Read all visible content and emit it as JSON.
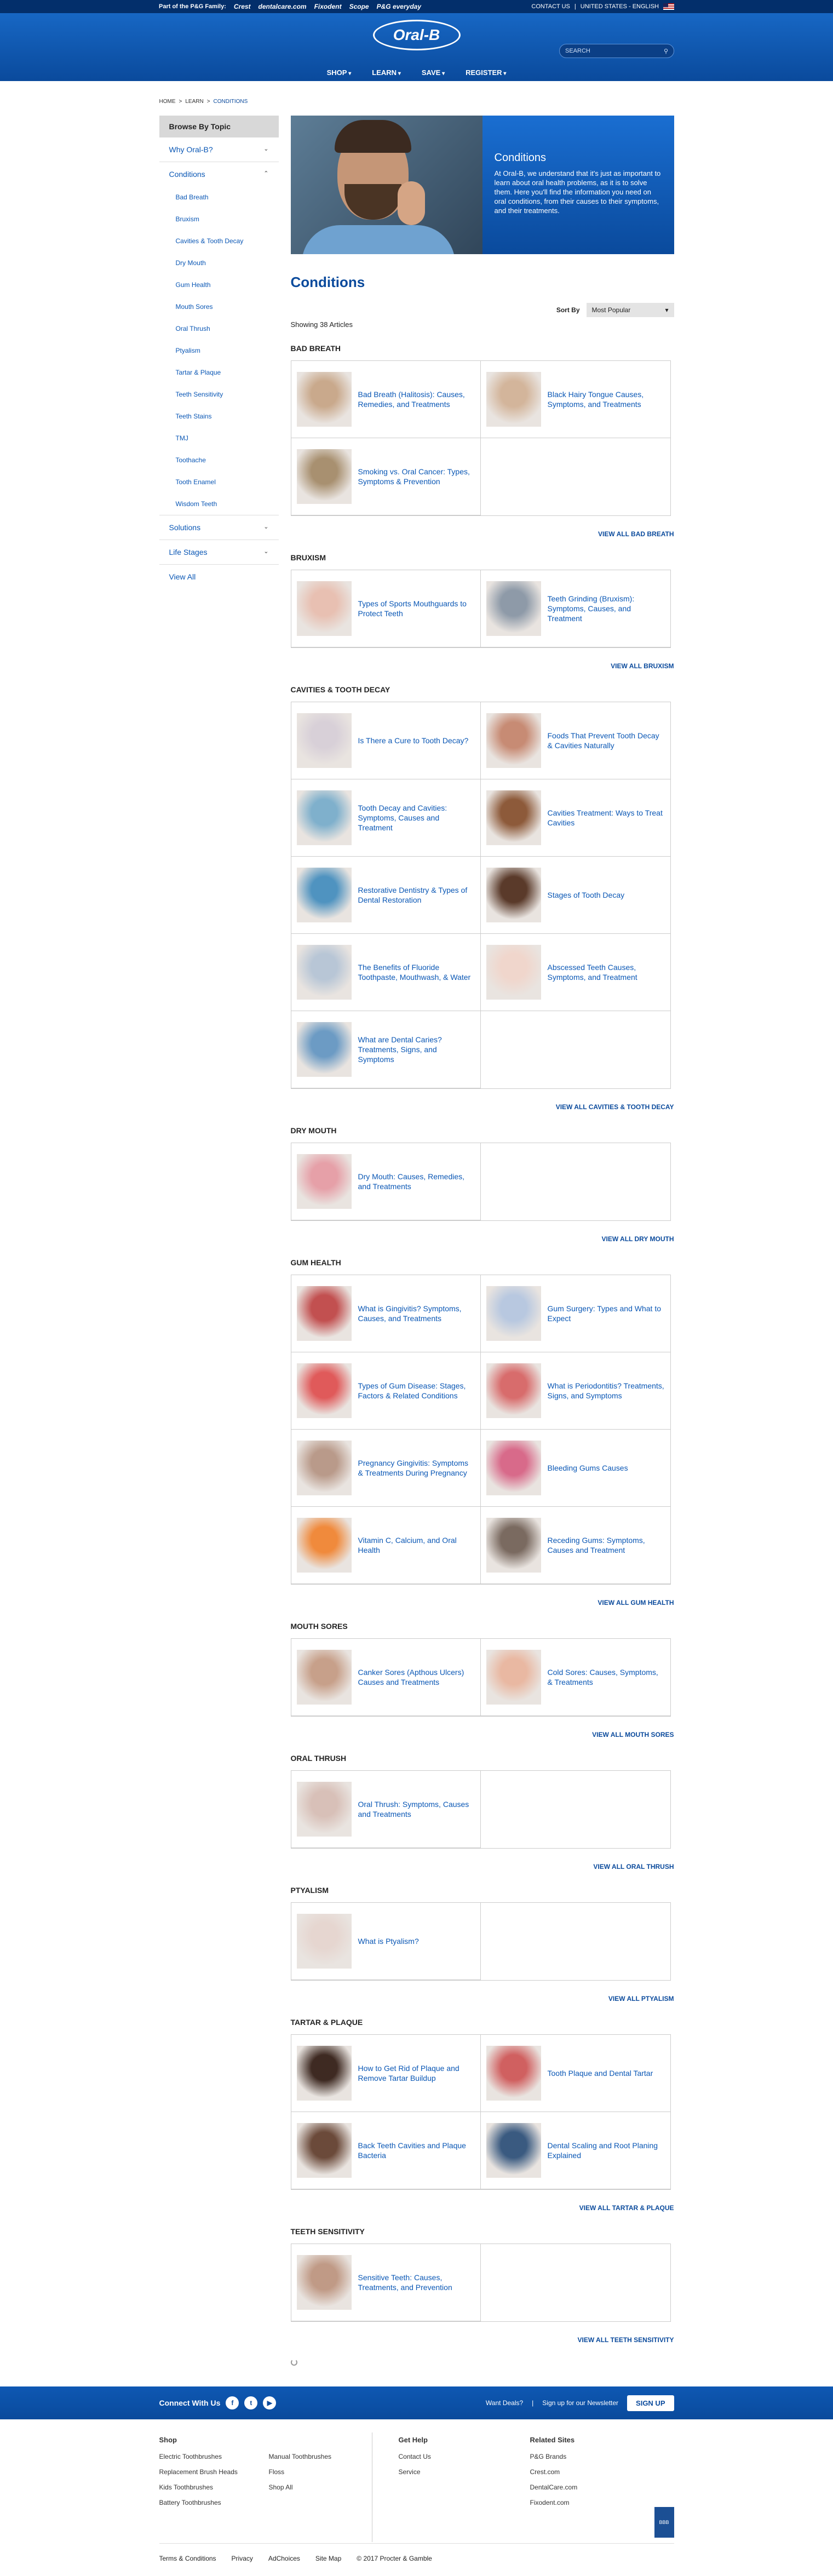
{
  "topbar": {
    "family": "Part of the P&G Family:",
    "brands": [
      "Crest",
      "dentalcare.com",
      "Fixodent",
      "Scope",
      "P&G everyday"
    ],
    "contact": "CONTACT US",
    "region": "UNITED STATES - ENGLISH"
  },
  "header": {
    "logo": "Oral-B",
    "search_placeholder": "SEARCH",
    "nav": [
      "SHOP",
      "LEARN",
      "SAVE",
      "REGISTER"
    ]
  },
  "breadcrumbs": [
    "HOME",
    ">",
    "LEARN",
    ">",
    "CONDITIONS"
  ],
  "sidebar": {
    "title": "Browse By Topic",
    "sections": [
      {
        "label": "Why Oral-B?"
      },
      {
        "label": "Conditions"
      }
    ],
    "subitems": [
      "Bad Breath",
      "Bruxism",
      "Cavities & Tooth Decay",
      "Dry Mouth",
      "Gum Health",
      "Mouth Sores",
      "Oral Thrush",
      "Ptyalism",
      "Tartar & Plaque",
      "Teeth Sensitivity",
      "Teeth Stains",
      "TMJ",
      "Toothache",
      "Tooth Enamel",
      "Wisdom Teeth"
    ],
    "lower": [
      {
        "label": "Solutions"
      },
      {
        "label": "Life Stages"
      }
    ],
    "view_all": "View All"
  },
  "hero": {
    "title": "Conditions",
    "text": "At Oral-B, we understand that it's just as important to learn about oral health problems, as it is to solve them. Here you'll find the information you need on oral conditions, from their causes to their symptoms, and their treatments."
  },
  "page_title": "Conditions",
  "sort": {
    "label": "Sort By",
    "value": "Most Popular"
  },
  "showing": "Showing 38 Articles",
  "categories": [
    {
      "title": "BAD BREATH",
      "view_all": "VIEW ALL BAD BREATH",
      "articles": [
        "Bad Breath (Halitosis): Causes, Remedies, and Treatments",
        "Black Hairy Tongue Causes, Symptoms, and Treatments",
        "Smoking vs. Oral Cancer: Types, Symptoms & Prevention"
      ]
    },
    {
      "title": "BRUXISM",
      "view_all": "VIEW ALL BRUXISM",
      "articles": [
        "Types of Sports Mouthguards to Protect Teeth",
        "Teeth Grinding (Bruxism): Symptoms, Causes, and Treatment"
      ]
    },
    {
      "title": "CAVITIES & TOOTH DECAY",
      "view_all": "VIEW ALL CAVITIES & TOOTH DECAY",
      "articles": [
        "Is There a Cure to Tooth Decay?",
        "Foods That Prevent Tooth Decay & Cavities Naturally",
        "Tooth Decay and Cavities: Symptoms, Causes and Treatment",
        "Cavities Treatment: Ways to Treat Cavities",
        "Restorative Dentistry & Types of Dental Restoration",
        "Stages of Tooth Decay",
        "The Benefits of Fluoride Toothpaste, Mouthwash, & Water",
        "Abscessed Teeth Causes, Symptoms, and Treatment",
        "What are Dental Caries? Treatments, Signs, and Symptoms"
      ]
    },
    {
      "title": "DRY MOUTH",
      "view_all": "VIEW ALL DRY MOUTH",
      "articles": [
        "Dry Mouth: Causes, Remedies, and Treatments"
      ]
    },
    {
      "title": "GUM HEALTH",
      "view_all": "VIEW ALL GUM HEALTH",
      "articles": [
        "What is Gingivitis? Symptoms, Causes, and Treatments",
        "Gum Surgery: Types and What to Expect",
        "Types of Gum Disease: Stages, Factors & Related Conditions",
        "What is Periodontitis? Treatments, Signs, and Symptoms",
        "Pregnancy Gingivitis: Symptoms & Treatments During Pregnancy",
        "Bleeding Gums Causes",
        "Vitamin C, Calcium, and Oral Health",
        "Receding Gums: Symptoms, Causes and Treatment"
      ]
    },
    {
      "title": "MOUTH SORES",
      "view_all": "VIEW ALL MOUTH SORES",
      "articles": [
        "Canker Sores (Apthous Ulcers) Causes and Treatments",
        "Cold Sores: Causes, Symptoms, & Treatments"
      ]
    },
    {
      "title": "ORAL THRUSH",
      "view_all": "VIEW ALL ORAL THRUSH",
      "articles": [
        "Oral Thrush: Symptoms, Causes and Treatments"
      ]
    },
    {
      "title": "PTYALISM",
      "view_all": "VIEW ALL PTYALISM",
      "articles": [
        "What is Ptyalism?"
      ]
    },
    {
      "title": "TARTAR & PLAQUE",
      "view_all": "VIEW ALL TARTAR & PLAQUE",
      "articles": [
        "How to Get Rid of Plaque and Remove Tartar Buildup",
        "Tooth Plaque and Dental Tartar",
        "Back Teeth Cavities and Plaque Bacteria",
        "Dental Scaling and Root Planing Explained"
      ]
    },
    {
      "title": "TEETH SENSITIVITY",
      "view_all": "VIEW ALL TEETH SENSITIVITY",
      "articles": [
        "Sensitive Teeth: Causes, Treatments, and Prevention"
      ]
    }
  ],
  "footer": {
    "connect": "Connect With Us",
    "social": [
      "f",
      "t",
      "▶"
    ],
    "deals": "Want Deals?",
    "newsletter": "Sign up for our Newsletter",
    "signup": "SIGN UP",
    "shop_title": "Shop",
    "shop_col1": [
      "Electric Toothbrushes",
      "Replacement Brush Heads",
      "Kids Toothbrushes",
      "Battery Toothbrushes"
    ],
    "shop_col2": [
      "Manual Toothbrushes",
      "Floss",
      "Shop All"
    ],
    "help_title": "Get Help",
    "help": [
      "Contact Us",
      "Service"
    ],
    "related_title": "Related Sites",
    "related": [
      "P&G Brands",
      "Crest.com",
      "DentalCare.com",
      "Fixodent.com"
    ],
    "bottom": [
      "Terms & Conditions",
      "Privacy",
      "AdChoices",
      "Site Map",
      "© 2017 Procter & Gamble"
    ]
  },
  "thumb_colors": [
    "#c9a98c",
    "#d3b59b",
    "#a89070",
    "#e8c0b2",
    "#8e9aa8",
    "#d8d0d8",
    "#c78b74",
    "#7fb0cc",
    "#8d5a3a",
    "#4f93c0",
    "#5a3a2a",
    "#b8c6d6",
    "#f0d6cc",
    "#6c9bc4",
    "#e6a0a8",
    "#c25050",
    "#b8c8e0",
    "#e05a5a",
    "#d86c6c",
    "#b99a8a",
    "#d86a8a",
    "#f08a3c",
    "#7a6a60",
    "#c7a08a",
    "#e9b8a2",
    "#d8c0b8",
    "#e6d6d0",
    "#3e2a22",
    "#d06060",
    "#6b4a3a",
    "#3a5a80",
    "#c09a86"
  ]
}
